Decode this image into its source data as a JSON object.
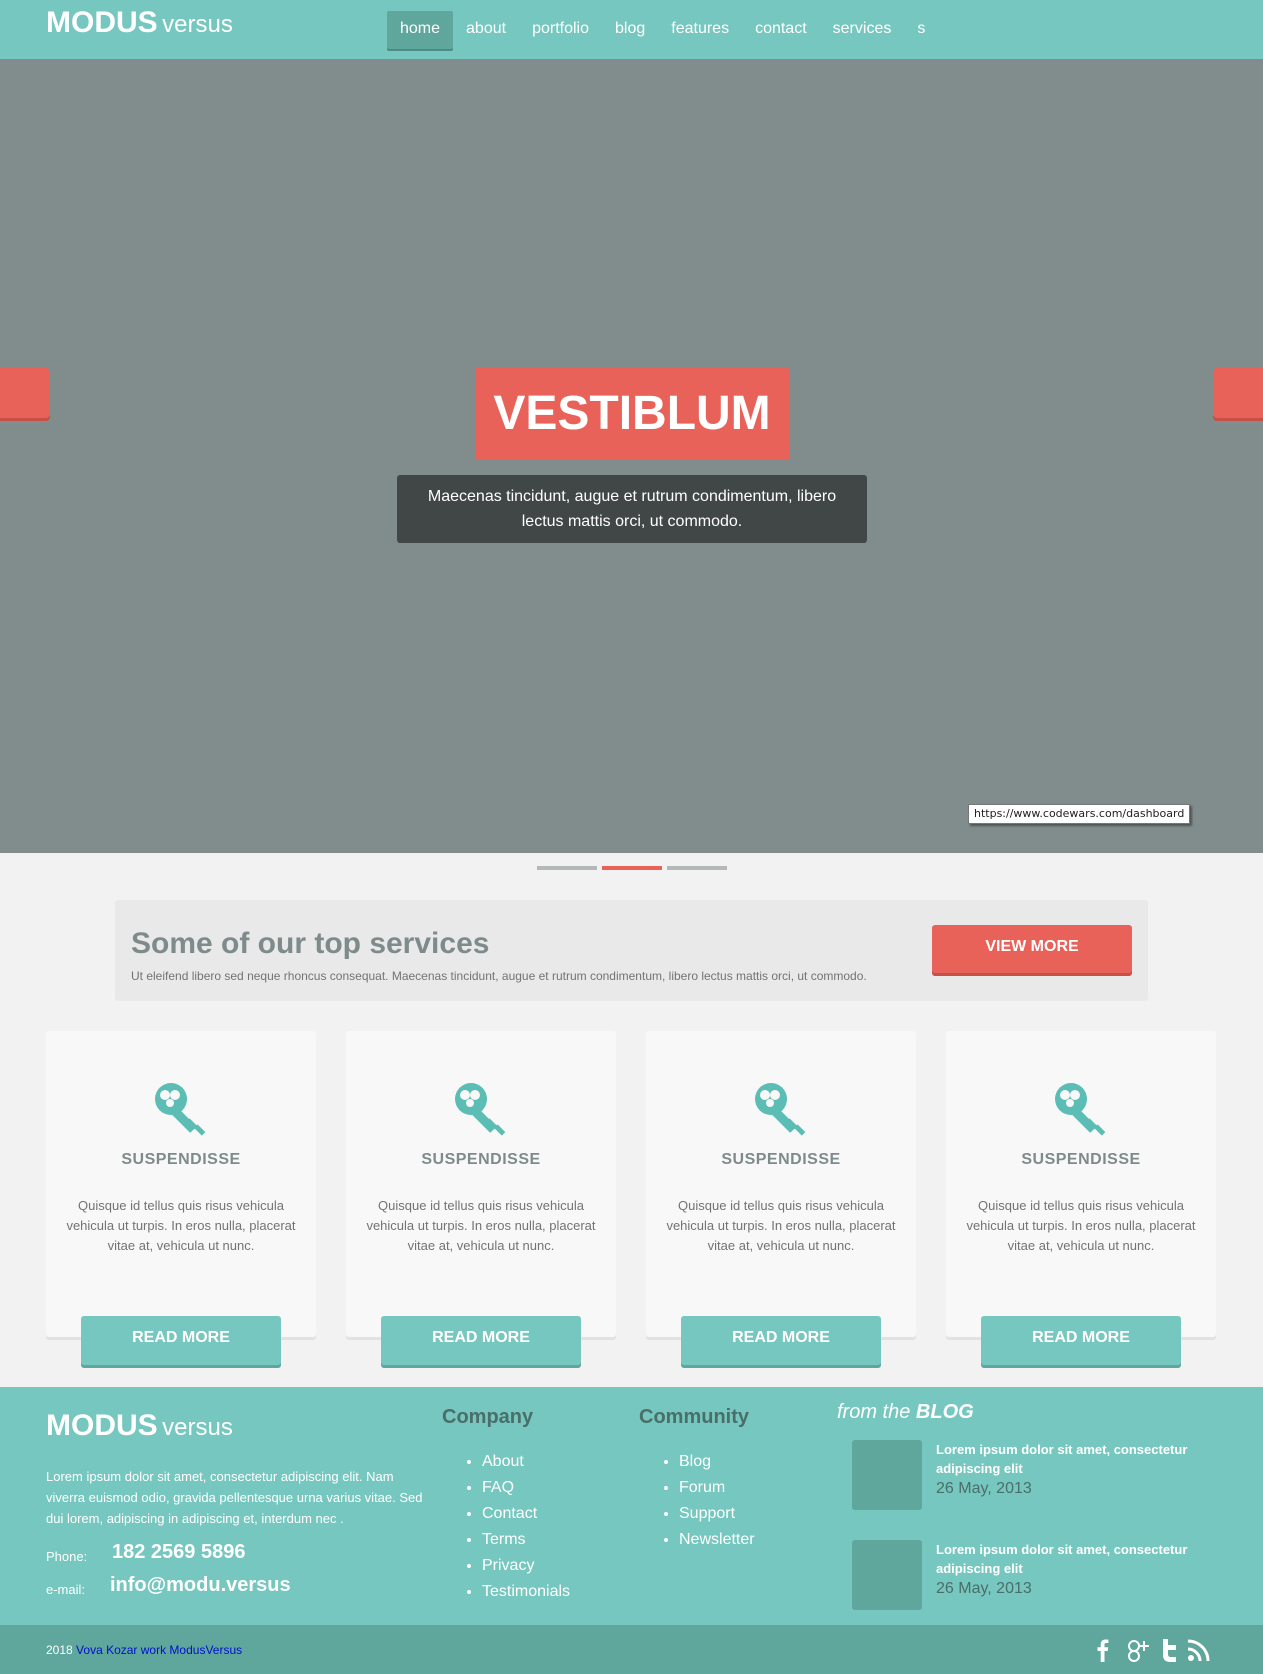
{
  "header": {
    "logo_bold": "MODUS",
    "logo_light": "versus",
    "nav": [
      {
        "label": "home",
        "active": true
      },
      {
        "label": "about",
        "active": false
      },
      {
        "label": "portfolio",
        "active": false
      },
      {
        "label": "blog",
        "active": false
      },
      {
        "label": "features",
        "active": false
      },
      {
        "label": "contact",
        "active": false
      },
      {
        "label": "services",
        "active": false
      },
      {
        "label": "s",
        "active": false
      }
    ]
  },
  "hero": {
    "title": "VESTIBLUM",
    "text": "Maecenas tincidunt, augue et rutrum condimentum, libero lectus mattis orci, ut commodo.",
    "tooltip": "https://www.codewars.com/dashboard",
    "active_slide": 2,
    "slide_count": 3
  },
  "services": {
    "title": "Some of our top services",
    "text": "Ut eleifend libero sed neque rhoncus consequat. Maecenas tincidunt, augue et rutrum condimentum, libero lectus mattis orci, ut commodo.",
    "button": "VIEW MORE",
    "cards": [
      {
        "icon": "key-icon",
        "title": "SUSPENDISSE",
        "text": "Quisque id tellus quis risus vehicula vehicula ut turpis. In eros nulla, placerat vitae at, vehicula ut nunc.",
        "button": "READ MORE"
      },
      {
        "icon": "key-icon",
        "title": "SUSPENDISSE",
        "text": "Quisque id tellus quis risus vehicula vehicula ut turpis. In eros nulla, placerat vitae at, vehicula ut nunc.",
        "button": "READ MORE"
      },
      {
        "icon": "key-icon",
        "title": "SUSPENDISSE",
        "text": "Quisque id tellus quis risus vehicula vehicula ut turpis. In eros nulla, placerat vitae at, vehicula ut nunc.",
        "button": "READ MORE"
      },
      {
        "icon": "key-icon",
        "title": "SUSPENDISSE",
        "text": "Quisque id tellus quis risus vehicula vehicula ut turpis. In eros nulla, placerat vitae at, vehicula ut nunc.",
        "button": "READ MORE"
      }
    ]
  },
  "footer": {
    "logo_bold": "MODUS",
    "logo_light": "versus",
    "description": "Lorem ipsum dolor sit amet, consectetur adipiscing elit. Nam viverra euismod odio, gravida pellentesque urna varius vitae. Sed dui lorem, adipiscing in adipiscing et, interdum nec .",
    "phone_label": "Phone:",
    "phone": "182 2569 5896",
    "email_label": "e-mail:",
    "email": "info@modu.versus",
    "company": {
      "title": "Company",
      "links": [
        "About",
        "FAQ",
        "Contact",
        "Terms",
        "Privacy",
        "Testimonials"
      ]
    },
    "community": {
      "title": "Community",
      "links": [
        "Blog",
        "Forum",
        "Support",
        "Newsletter"
      ]
    },
    "blog": {
      "title_prefix": "from the",
      "title_bold": "BLOG",
      "posts": [
        {
          "title": "Lorem ipsum dolor sit amet, consectetur adipiscing elit",
          "date": "26 May, 2013"
        },
        {
          "title": "Lorem ipsum dolor sit amet, consectetur adipiscing elit",
          "date": "26 May, 2013"
        }
      ]
    }
  },
  "bottom": {
    "year": "2018",
    "link_text": "Vova Kozar work ModusVersus",
    "social": [
      "facebook-icon",
      "google-plus-icon",
      "twitter-icon",
      "rss-icon"
    ]
  },
  "colors": {
    "teal": "#76c7bf",
    "teal_dark": "#5fa69d",
    "coral": "#e8625a",
    "hero_bg": "#808d8c"
  }
}
